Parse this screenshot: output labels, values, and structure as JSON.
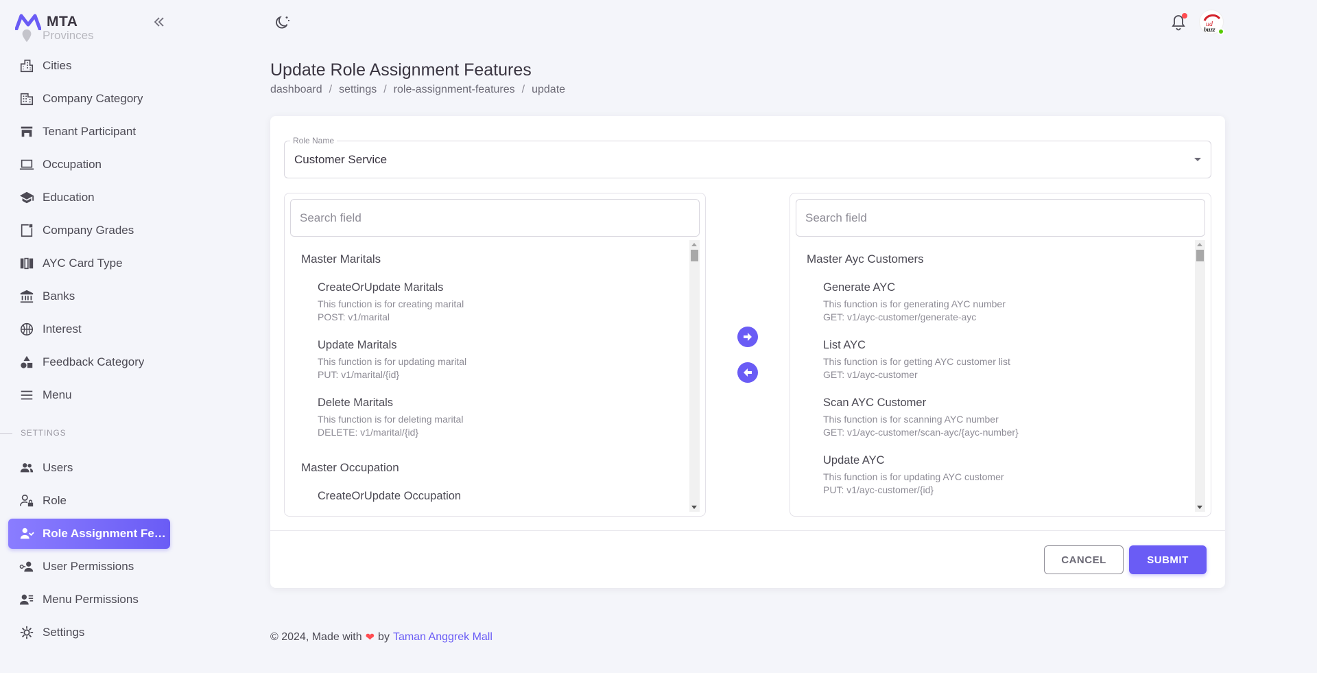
{
  "brand": {
    "name": "MTA"
  },
  "sidebar": {
    "items": [
      {
        "label": "Provinces",
        "icon": "map-pin-icon"
      },
      {
        "label": "Cities",
        "icon": "city-icon"
      },
      {
        "label": "Company Category",
        "icon": "building-icon"
      },
      {
        "label": "Tenant Participant",
        "icon": "store-icon"
      },
      {
        "label": "Occupation",
        "icon": "laptop-icon"
      },
      {
        "label": "Education",
        "icon": "school-icon"
      },
      {
        "label": "Company Grades",
        "icon": "note-icon"
      },
      {
        "label": "AYC Card Type",
        "icon": "card-type-icon"
      },
      {
        "label": "Banks",
        "icon": "bank-icon"
      },
      {
        "label": "Interest",
        "icon": "basketball-icon"
      },
      {
        "label": "Feedback Category",
        "icon": "shapes-icon"
      },
      {
        "label": "Menu",
        "icon": "menu-icon"
      }
    ],
    "section_settings": "SETTINGS",
    "settings_items": [
      {
        "label": "Users",
        "icon": "users-icon"
      },
      {
        "label": "Role",
        "icon": "user-lock-icon"
      },
      {
        "label": "Role Assignment Fea...",
        "icon": "user-assign-icon",
        "active": true
      },
      {
        "label": "User Permissions",
        "icon": "user-key-icon"
      },
      {
        "label": "Menu Permissions",
        "icon": "user-list-icon"
      },
      {
        "label": "Settings",
        "icon": "gear-icon"
      }
    ]
  },
  "header": {
    "title": "Update Role Assignment Features",
    "breadcrumb": [
      "dashboard",
      "settings",
      "role-assignment-features",
      "update"
    ]
  },
  "form": {
    "role_label": "Role Name",
    "role_value": "Customer Service",
    "left_search_placeholder": "Search field",
    "right_search_placeholder": "Search field",
    "left_list": {
      "group1": "Master Maritals",
      "items1": [
        {
          "name": "CreateOrUpdate Maritals",
          "desc": "This function is for creating marital",
          "endpoint": "POST: v1/marital"
        },
        {
          "name": "Update Maritals",
          "desc": "This function is for updating marital",
          "endpoint": "PUT: v1/marital/{id}"
        },
        {
          "name": "Delete Maritals",
          "desc": "This function is for deleting marital",
          "endpoint": "DELETE: v1/marital/{id}"
        }
      ],
      "group2": "Master Occupation",
      "items2": [
        {
          "name": "CreateOrUpdate Occupation"
        }
      ]
    },
    "right_list": {
      "group1": "Master Ayc Customers",
      "items1": [
        {
          "name": "Generate AYC",
          "desc": "This function is for generating AYC number",
          "endpoint": "GET: v1/ayc-customer/generate-ayc"
        },
        {
          "name": "List AYC",
          "desc": "This function is for getting AYC customer list",
          "endpoint": "GET: v1/ayc-customer"
        },
        {
          "name": "Scan AYC Customer",
          "desc": "This function is for scanning AYC number",
          "endpoint": "GET: v1/ayc-customer/scan-ayc/{ayc-number}"
        },
        {
          "name": "Update AYC",
          "desc": "This function is for updating AYC customer",
          "endpoint": "PUT: v1/ayc-customer/{id}"
        }
      ]
    },
    "cancel_label": "CANCEL",
    "submit_label": "SUBMIT"
  },
  "footer": {
    "prefix": "© 2024, Made with",
    "by": "by",
    "link": "Taman Anggrek Mall"
  },
  "colors": {
    "primary": "#6a5cf5",
    "background": "#f4f5fa",
    "danger": "#ff4c51",
    "success": "#56ca00"
  }
}
